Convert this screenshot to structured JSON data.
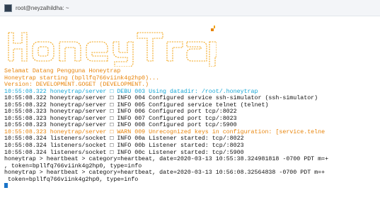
{
  "window": {
    "title": "root@neyzalhildha: ~"
  },
  "banner": {
    "logo_text": "HoneyTrap",
    "logo_color": "#f2a51a"
  },
  "terminal": {
    "colors": {
      "orange": "#e8850c",
      "cyan": "#1aa8d6",
      "text": "#111111",
      "cursor": "#1a74c8"
    },
    "lines": [
      {
        "text": "Selamat Datang Pengguna Honeytrap",
        "style": "orange"
      },
      {
        "text": "Honeytrap starting (bpllfq766viink4g2hp0)...",
        "style": "orange"
      },
      {
        "text": "Version: DEVELOPMENT.GOGET (DEVELOPMENT.)",
        "style": "orange"
      },
      {
        "text": "10:55:08.322 honeytrap/server □ DEBU 003 Using datadir: /root/.honeytrap",
        "style": "cyan"
      },
      {
        "text": "10:55:08.322 honeytrap/server □ INFO 004 Configured service ssh-simulator (ssh-simulator)",
        "style": "black"
      },
      {
        "text": "10:55:08.322 honeytrap/server □ INFO 005 Configured service telnet (telnet)",
        "style": "black"
      },
      {
        "text": "10:55:08.323 honeytrap/server □ INFO 006 Configured port tcp/:8022",
        "style": "black"
      },
      {
        "text": "10:55:08.323 honeytrap/server □ INFO 007 Configured port tcp/:8023",
        "style": "black"
      },
      {
        "text": "10:55:08.323 honeytrap/server □ INFO 008 Configured port tcp/:5900",
        "style": "black"
      },
      {
        "text": "10:55:08.323 honeytrap/server □ WARN 009 Unrecognized keys in configuration: [service.telne",
        "style": "orange"
      },
      {
        "text": "10:55:08.324 listeners/socket □ INFO 00a Listener started: tcp/:8022",
        "style": "black"
      },
      {
        "text": "10:55:08.324 listeners/socket □ INFO 00b Listener started: tcp/:8023",
        "style": "black"
      },
      {
        "text": "10:55:08.324 listeners/socket □ INFO 00c Listener started: tcp/:5900",
        "style": "black"
      },
      {
        "text": "honeytrap > heartbeat > category=heartbeat, date=2020-03-13 10:55:38.324981818 -0700 PDT m=+",
        "style": "black"
      },
      {
        "text": ", token=bpllfq766viink4g2hp0, type=info",
        "style": "black"
      },
      {
        "text": "honeytrap > heartbeat > category=heartbeat, date=2020-03-13 10:56:08.32564838 -0700 PDT m=+",
        "style": "black"
      },
      {
        "text": " token=bpllfq766viink4g2hp0, type=info",
        "style": "black"
      }
    ]
  }
}
